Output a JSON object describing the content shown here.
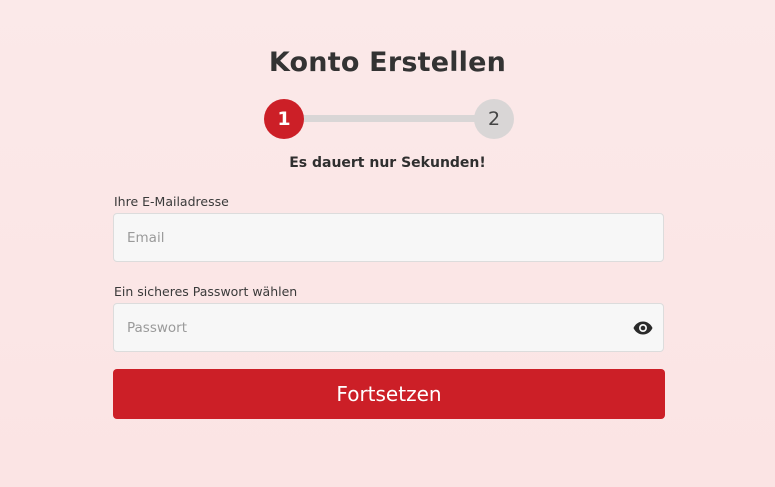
{
  "page": {
    "title": "Konto Erstellen",
    "subtitle": "Es dauert nur Sekunden!"
  },
  "stepper": {
    "steps": [
      {
        "number": "1",
        "state": "active"
      },
      {
        "number": "2",
        "state": "inactive"
      }
    ]
  },
  "form": {
    "email": {
      "label": "Ihre E-Mailadresse",
      "placeholder": "Email",
      "value": ""
    },
    "password": {
      "label": "Ein sicheres Passwort wählen",
      "placeholder": "Passwort",
      "value": "",
      "toggle_icon": "eye-icon"
    },
    "submit_label": "Fortsetzen"
  },
  "colors": {
    "accent": "#cc1f27",
    "background": "#fbe9e9",
    "inactive_step": "#d9d6d6"
  }
}
